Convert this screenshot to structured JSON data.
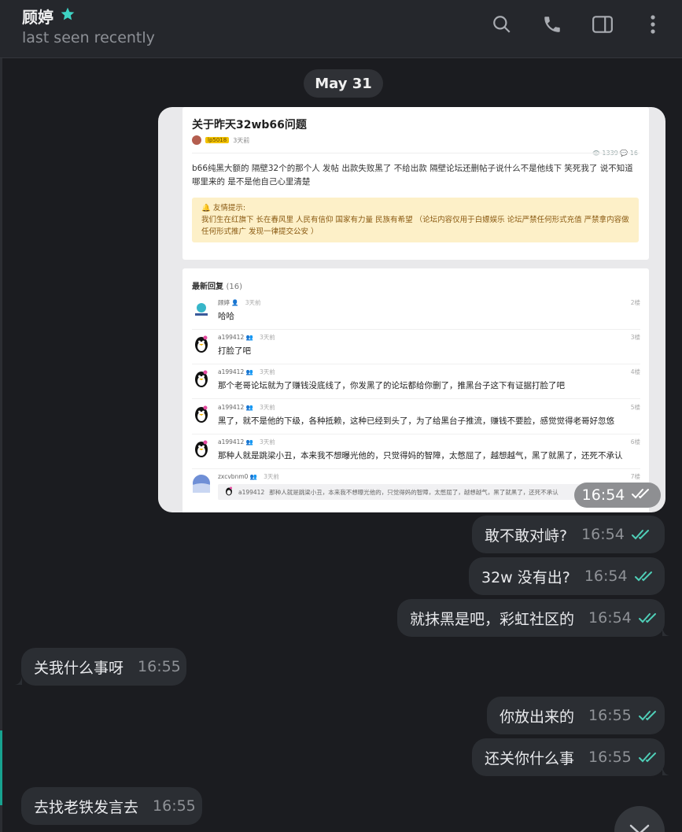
{
  "header": {
    "contact_name": "顾婷",
    "status": "last seen recently",
    "icons": [
      "star-icon",
      "search-icon",
      "phone-icon",
      "sidebar-toggle-icon",
      "more-vert-icon"
    ]
  },
  "date_separator": "May 31",
  "screenshot_post": {
    "title": "关于昨天32wb66问题",
    "author_tag": "lp5018",
    "posted": "3天前",
    "stats": "👁 1339 💬 16",
    "body": "b66纯黑大额的 隔壁32个的那个人 发帖 出款失败黑了 不给出款 隔壁论坛还删帖子说什么不是他线下 笑死我了 说不知道哪里来的 是不是他自己心里清楚",
    "notice_title": "🔔 友情提示:",
    "notice_text": "我们生在红旗下 长在春风里 人民有信仰 国家有力量 民族有希望 （论坛内容仅用于白嫖娱乐 论坛严禁任何形式充值 严禁拿内容做任何形式推广 发现一律提交公安 ）",
    "replies_heading": "最新回复",
    "replies_count": "(16)",
    "replies": [
      {
        "user": "顾婷 👤",
        "time": "3天前",
        "floor": "2楼",
        "text": "哈哈"
      },
      {
        "user": "a199412 👥",
        "time": "3天前",
        "floor": "3楼",
        "text": "打脸了吧"
      },
      {
        "user": "a199412 👥",
        "time": "3天前",
        "floor": "4楼",
        "text": "那个老哥论坛就为了赚钱没底线了，你发黑了的论坛都给你删了，推黑台子这下有证据打脸了吧"
      },
      {
        "user": "a199412 👥",
        "time": "3天前",
        "floor": "5楼",
        "text": "黑了，就不是他的下级，各种抵赖，这种已经到头了，为了给黑台子推流，赚钱不要脸，感觉觉得老哥好忽悠"
      },
      {
        "user": "a199412 👥",
        "time": "3天前",
        "floor": "6楼",
        "text": "那种人就是跳梁小丑，本来我不想曝光他的，只觉得妈的智障，太憋屈了，越想越气，黑了就黑了，还死不承认"
      },
      {
        "user": "zxcvbnm0 👥",
        "time": "3天前",
        "floor": "7楼",
        "quote_user": "a199412",
        "quote_text": "那种人就是跳梁小丑，本来我不想曝光他的，只觉得妈的智障，太憋屈了，越想越气，黑了就黑了，还死不承认"
      }
    ],
    "time": "16:54"
  },
  "messages": [
    {
      "dir": "out",
      "text": "敢不敢对峙?",
      "time": "16:54"
    },
    {
      "dir": "out",
      "text": "32w 没有出?",
      "time": "16:54"
    },
    {
      "dir": "out",
      "text": "就抹黑是吧，彩虹社区的",
      "time": "16:54"
    },
    {
      "dir": "in",
      "text": "关我什么事呀",
      "time": "16:55"
    },
    {
      "dir": "out",
      "text": "你放出来的",
      "time": "16:55"
    },
    {
      "dir": "out",
      "text": "还关你什么事",
      "time": "16:55"
    },
    {
      "dir": "in",
      "text": "去找老铁发言去",
      "time": "16:55"
    }
  ],
  "colors": {
    "background": "#1b1c20",
    "header": "#25272c",
    "bubble": "#2b2e33",
    "accent": "#3ed3c4",
    "read_check": "#4fcfb8"
  }
}
